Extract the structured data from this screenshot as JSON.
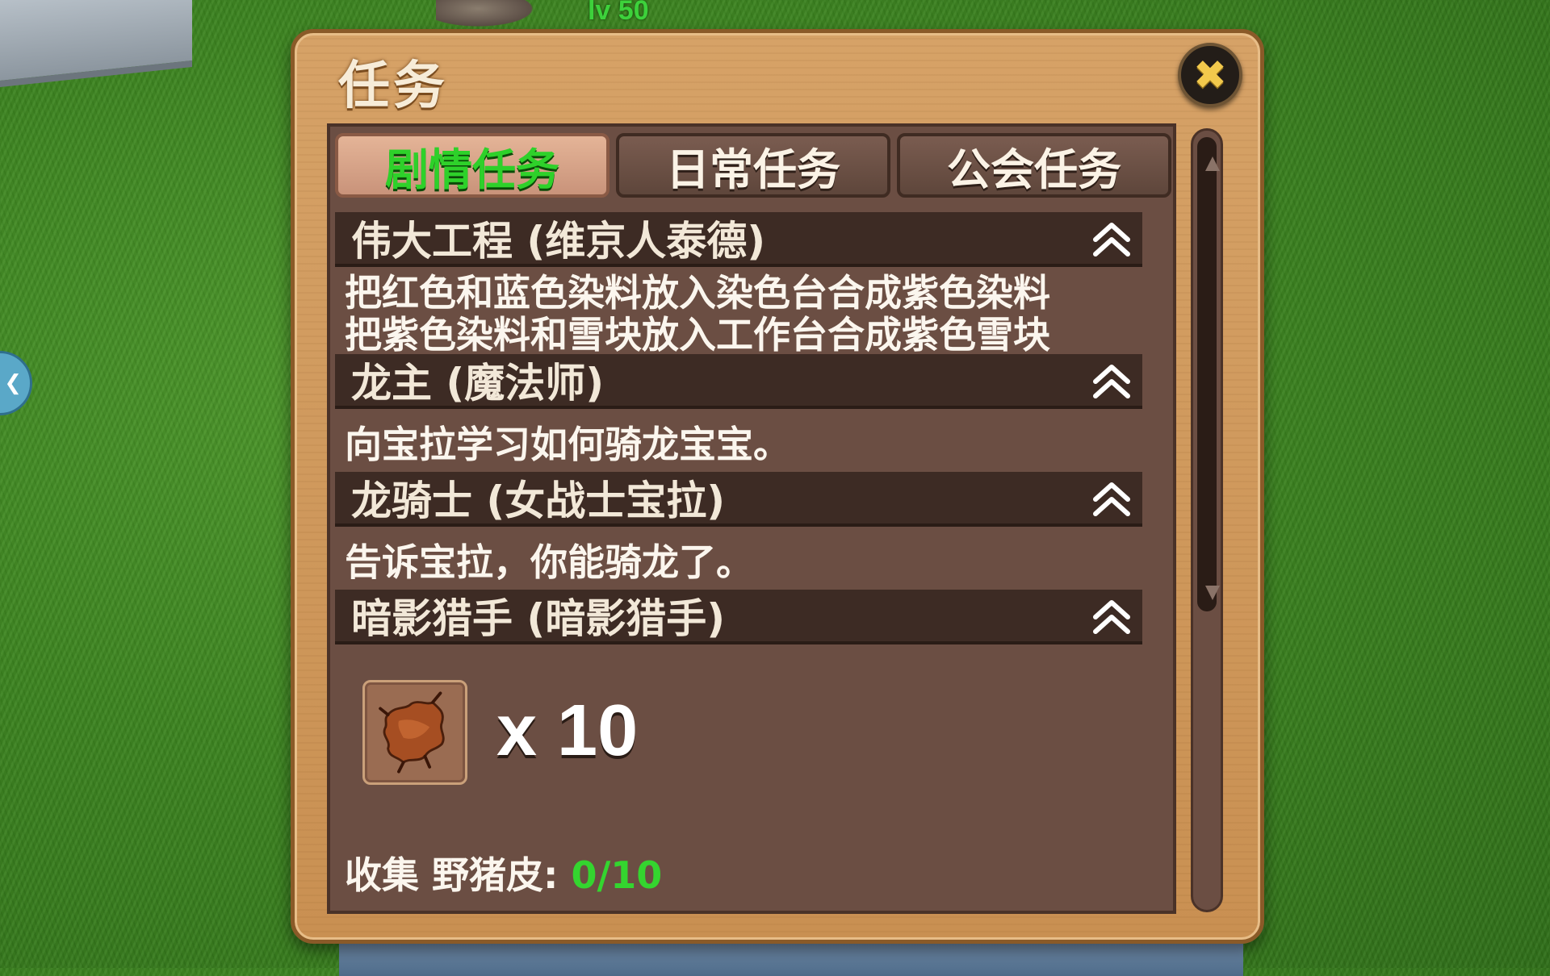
{
  "scene": {
    "player_level": "lv 50"
  },
  "dialog": {
    "title": "任务",
    "close_icon": "close-x-icon"
  },
  "tabs": [
    {
      "label": "剧情任务",
      "active": true
    },
    {
      "label": "日常任务",
      "active": false
    },
    {
      "label": "公会任务",
      "active": false
    }
  ],
  "quests": [
    {
      "title": "伟大工程 (维京人泰德)",
      "lines": [
        "把红色和蓝色染料放入染色台合成紫色染料",
        "把紫色染料和雪块放入工作台合成紫色雪块"
      ]
    },
    {
      "title": "龙主 (魔法师)",
      "lines": [
        "向宝拉学习如何骑龙宝宝。"
      ]
    },
    {
      "title": "龙骑士 (女战士宝拉)",
      "lines": [
        "告诉宝拉，你能骑龙了。"
      ]
    },
    {
      "title": "暗影猎手 (暗影猎手)",
      "reward": {
        "icon": "boar-hide-icon",
        "quantity": "x 10"
      },
      "objective": {
        "label": "收集 野猪皮: ",
        "progress": "0/10"
      }
    }
  ],
  "colors": {
    "active_tab_text": "#2ed12a",
    "progress_text": "#34d52f",
    "panel_bg": "#6b4e43",
    "header_bg": "#3d2b24",
    "frame_wood": "#d6a267",
    "close_x": "#f2c94c"
  }
}
